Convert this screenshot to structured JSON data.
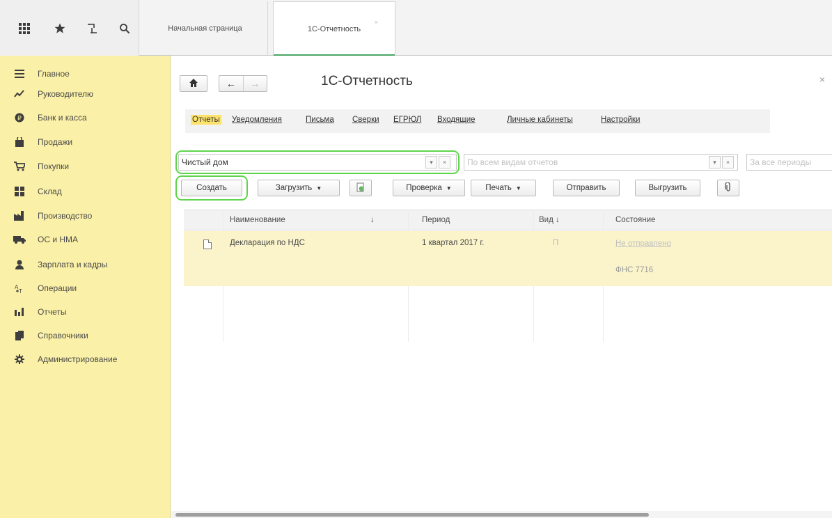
{
  "topbar": {
    "icons": [
      "apps-grid-icon",
      "star-icon",
      "history-icon",
      "search-icon"
    ],
    "tabs": [
      {
        "label": "Начальная страница"
      },
      {
        "label": "1С-Отчетность",
        "close": "×"
      }
    ]
  },
  "sidebar": {
    "items": [
      {
        "label": "Главное",
        "icon": "menu-lines-icon"
      },
      {
        "label": "Руководителю",
        "icon": "chart-trend-icon"
      },
      {
        "label": "Банк и касса",
        "icon": "bank-icon"
      },
      {
        "label": "Продажи",
        "icon": "shopping-bag-icon"
      },
      {
        "label": "Покупки",
        "icon": "cart-icon"
      },
      {
        "label": "Склад",
        "icon": "warehouse-icon"
      },
      {
        "label": "Производство",
        "icon": "factory-icon"
      },
      {
        "label": "ОС и НМА",
        "icon": "truck-icon"
      },
      {
        "label": "Зарплата и кадры",
        "icon": "person-icon"
      },
      {
        "label": "Операции",
        "icon": "operations-icon"
      },
      {
        "label": "Отчеты",
        "icon": "bar-chart-icon"
      },
      {
        "label": "Справочники",
        "icon": "books-icon"
      },
      {
        "label": "Администрирование",
        "icon": "gear-icon"
      }
    ]
  },
  "main": {
    "title": "1С-Отчетность",
    "close": "×",
    "nav": {
      "home": "🏠",
      "back": "←",
      "forward": "→"
    },
    "sections": [
      "Отчеты",
      "Уведомления",
      "Письма",
      "Сверки",
      "ЕГРЮЛ",
      "Входящие",
      "Личные кабинеты",
      "Настройки"
    ],
    "active_section": "Отчеты",
    "filters": {
      "organization": "Чистый дом",
      "report_kind_placeholder": "По всем видам отчетов",
      "period_placeholder": "За все периоды"
    },
    "toolbar": {
      "create": "Создать",
      "load": "Загрузить",
      "check": "Проверка",
      "print": "Печать",
      "send": "Отправить",
      "export": "Выгрузить",
      "attach": "@"
    },
    "table": {
      "columns": [
        "Наименование",
        "Период",
        "Вид",
        "Состояние"
      ],
      "sort_arrow": "↓",
      "rows": [
        {
          "name": "Декларация по НДС",
          "period": "1 квартал 2017 г.",
          "kind": "П",
          "status": "Не отправлено",
          "recipient": "ФНС 7716"
        }
      ]
    }
  }
}
